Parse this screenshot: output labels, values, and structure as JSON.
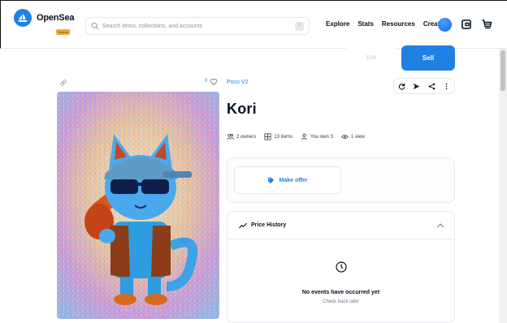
{
  "brand": {
    "name": "OpenSea",
    "badge": "Testnet",
    "accent": "#2081e2"
  },
  "search": {
    "placeholder": "Search items, collections, and accounts",
    "shortcut": "/"
  },
  "nav": {
    "items": [
      "Explore",
      "Stats",
      "Resources",
      "Create"
    ]
  },
  "icons": [
    "search-icon",
    "avatar-icon",
    "wallet-icon",
    "cart-icon",
    "link-icon",
    "heart-icon",
    "refresh-icon",
    "send-icon",
    "share-icon",
    "more-icon",
    "owners-icon",
    "items-icon",
    "user-icon",
    "eye-icon",
    "tag-icon",
    "trend-icon",
    "chevron-up-icon",
    "clock-icon"
  ],
  "toolbar": {
    "edit_label": "Edit",
    "sell_label": "Sell"
  },
  "item": {
    "favorites": "0",
    "collection": "Poco V2",
    "title": "Kori",
    "stats": {
      "owners": "2 owners",
      "items": "13 items",
      "you_own": "You own 3",
      "views": "1 view"
    }
  },
  "offer": {
    "label": "Make offer"
  },
  "price_history": {
    "title": "Price History",
    "empty_title": "No events have occurred yet",
    "empty_sub": "Check back later"
  }
}
